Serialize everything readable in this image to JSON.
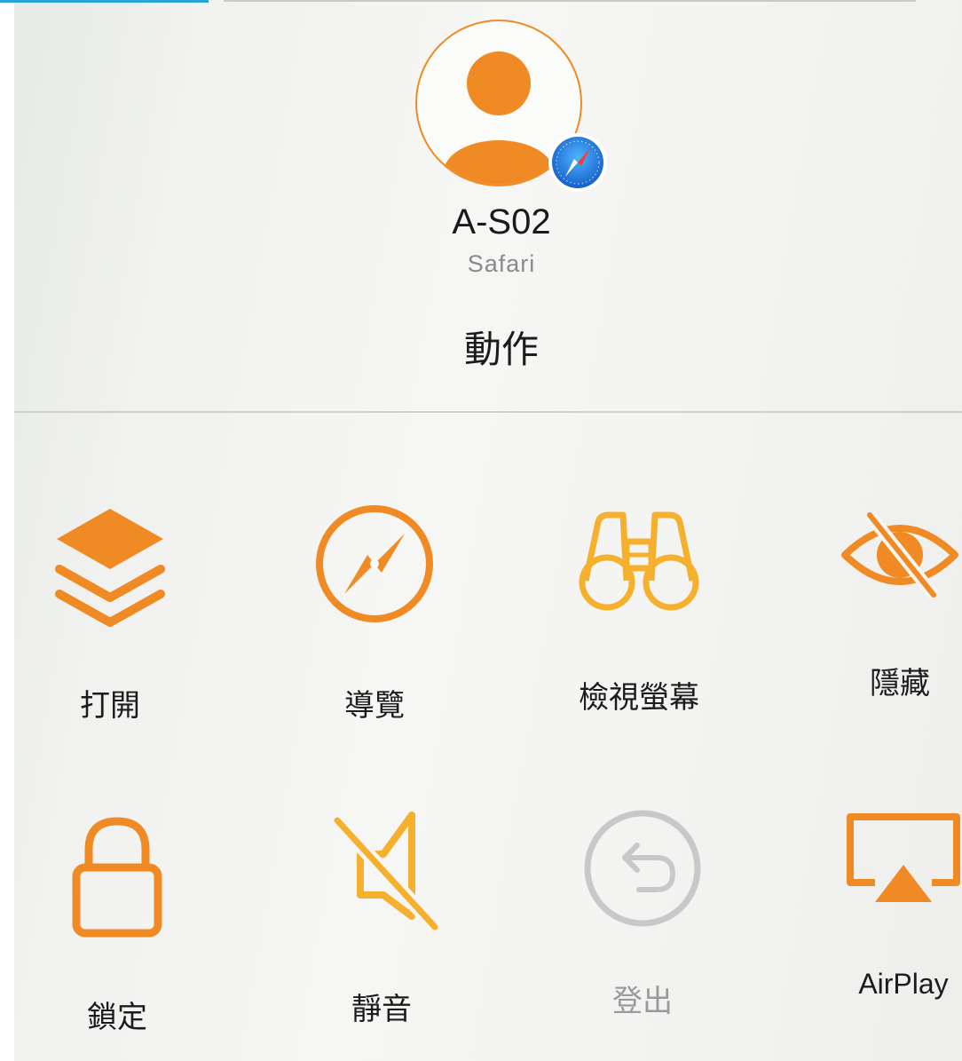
{
  "header": {
    "device_name": "A-S02",
    "app_name": "Safari",
    "avatar_icon": "person-icon",
    "badge_icon": "safari-compass-icon"
  },
  "section_title": "動作",
  "actions": [
    {
      "label": "打開",
      "icon": "layers-icon",
      "enabled": true
    },
    {
      "label": "導覽",
      "icon": "compass-icon",
      "enabled": true
    },
    {
      "label": "檢視螢幕",
      "icon": "binoculars-icon",
      "enabled": true
    },
    {
      "label": "隱藏",
      "icon": "eye-slash-icon",
      "enabled": true
    },
    {
      "label": "鎖定",
      "icon": "lock-icon",
      "enabled": true
    },
    {
      "label": "靜音",
      "icon": "speaker-muted-icon",
      "enabled": true
    },
    {
      "label": "登出",
      "icon": "logout-arrow-icon",
      "enabled": false
    },
    {
      "label": "AirPlay",
      "icon": "airplay-icon",
      "enabled": true
    }
  ],
  "colors": {
    "accent": "#f08a24",
    "accent_light": "#f5b02e",
    "disabled": "#c8c8c8",
    "safari_blue": "#1f7fe0"
  }
}
